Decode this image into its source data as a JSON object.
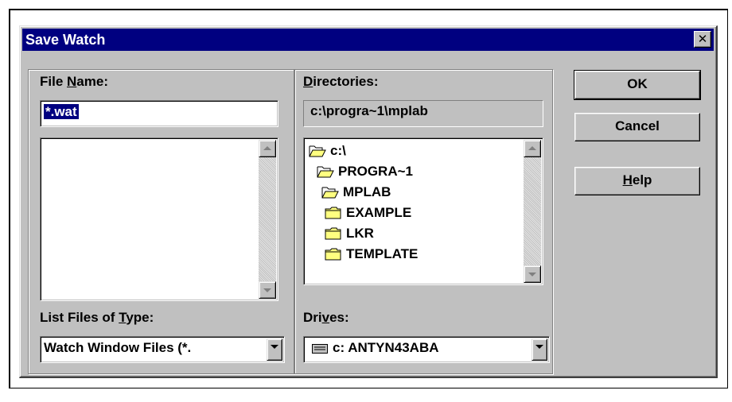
{
  "dialog": {
    "title": "Save Watch",
    "close_glyph": "✕"
  },
  "file_name": {
    "label_pre": "File ",
    "label_key": "N",
    "label_post": "ame:",
    "value": "*.wat",
    "files": []
  },
  "directories": {
    "label_key": "D",
    "label_post": "irectories:",
    "current_path": "c:\\progra~1\\mplab",
    "tree": [
      {
        "label": "c:\\",
        "icon": "open-folder-icon"
      },
      {
        "label": "PROGRA~1",
        "icon": "open-folder-icon"
      },
      {
        "label": "MPLAB",
        "icon": "open-folder-icon"
      },
      {
        "label": "EXAMPLE",
        "icon": "folder-icon"
      },
      {
        "label": "LKR",
        "icon": "folder-icon"
      },
      {
        "label": "TEMPLATE",
        "icon": "folder-icon"
      }
    ]
  },
  "file_type": {
    "label_pre": "List Files of ",
    "label_key": "T",
    "label_post": "ype:",
    "selected": "Watch Window Files (*."
  },
  "drives": {
    "label_pre": "Dri",
    "label_key": "v",
    "label_post": "es:",
    "selected": "c: ANTYN43ABA",
    "icon": "drive-icon"
  },
  "buttons": {
    "ok": "OK",
    "cancel": "Cancel",
    "help_key": "H",
    "help_post": "elp"
  },
  "colors": {
    "title_bar": "#000080",
    "face": "#c0c0c0",
    "folder_yellow": "#ffff80"
  }
}
